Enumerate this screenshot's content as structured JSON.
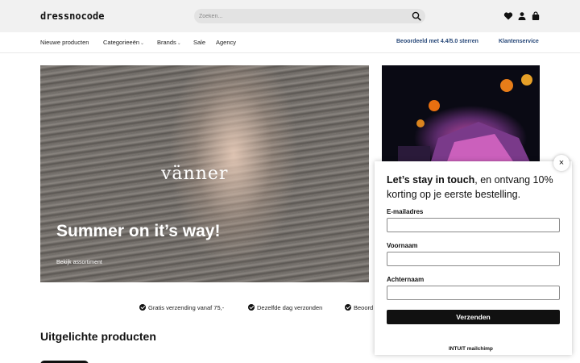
{
  "header": {
    "logo": "dressnocode",
    "search_placeholder": "Zoeken..."
  },
  "nav": {
    "items": [
      {
        "label": "Nieuwe producten",
        "has_dropdown": false
      },
      {
        "label": "Categorieeën",
        "has_dropdown": true
      },
      {
        "label": "Brands",
        "has_dropdown": true
      },
      {
        "label": "Sale",
        "has_dropdown": false
      },
      {
        "label": "Agency",
        "has_dropdown": false
      }
    ],
    "rating": "Beoordeeld met 4.4/5.0 sterren",
    "service": "Klantenservice",
    "chevron": "⌄"
  },
  "hero": {
    "brand": "vänner",
    "title": "Summer on it’s way!",
    "link": "Bekijk assortiment"
  },
  "usps": [
    "Gratis verzending vanaf 75,-",
    "Dezelfde dag verzonden",
    "Beoord"
  ],
  "section_title": "Uitgelichte producten",
  "popup": {
    "heading_bold": "Let’s stay in touch",
    "heading_rest": ", en ontvang 10% korting op je eerste bestelling.",
    "email_label": "E-mailadres",
    "firstname_label": "Voornaam",
    "lastname_label": "Achternaam",
    "submit_label": "Verzenden",
    "close_glyph": "×",
    "footer_logo": "INTUIT mailchimp"
  },
  "colors": {
    "nav_accent": "#2a4a7a",
    "button_bg": "#111111"
  }
}
